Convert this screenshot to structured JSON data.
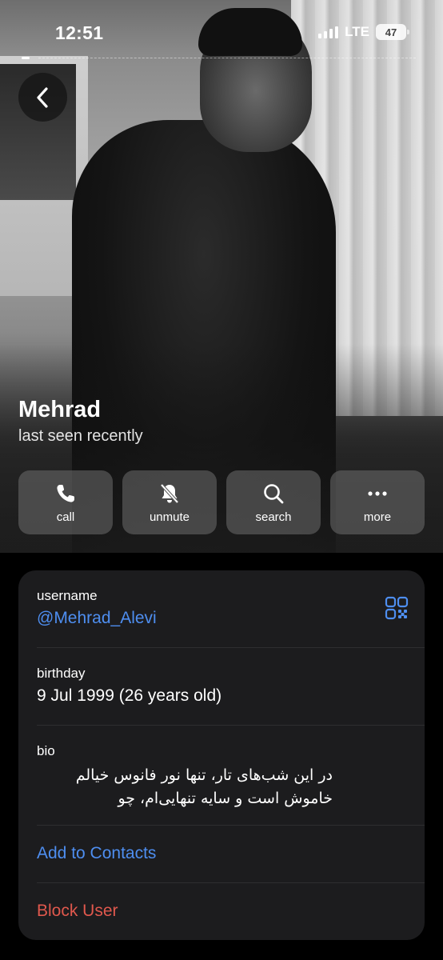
{
  "status_bar": {
    "time": "12:51",
    "network": "LTE",
    "battery": "47"
  },
  "profile": {
    "name": "Mehrad",
    "status": "last seen recently"
  },
  "actions": [
    {
      "label": "call",
      "icon": "phone-icon"
    },
    {
      "label": "unmute",
      "icon": "bell-slash-icon"
    },
    {
      "label": "search",
      "icon": "search-icon"
    },
    {
      "label": "more",
      "icon": "ellipsis-icon"
    }
  ],
  "info": {
    "username_label": "username",
    "username_value": "@Mehrad_Alevi",
    "birthday_label": "birthday",
    "birthday_value": "9 Jul 1999 (26 years old)",
    "bio_label": "bio",
    "bio_value": "در این شب‌های تار، تنها نور فانوس خیالم خاموش است و سایه تنهایی‌ام، چو",
    "add_contact": "Add to Contacts",
    "block_user": "Block User"
  },
  "colors": {
    "accent": "#4e8ef0",
    "danger": "#e0584d",
    "card": "#1c1c1e"
  }
}
